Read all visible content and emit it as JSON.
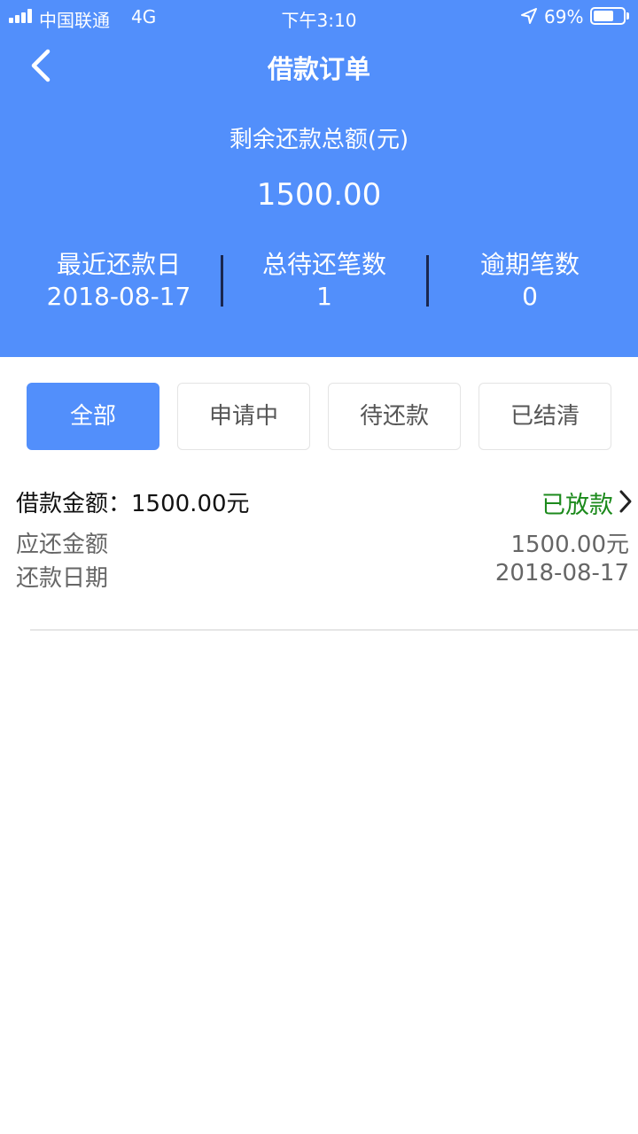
{
  "status_bar": {
    "carrier": "中国联通",
    "network": "4G",
    "time": "下午3:10",
    "battery_percent": "69%",
    "battery_level": 0.69
  },
  "nav": {
    "title": "借款订单",
    "back_icon": "chevron-left-icon"
  },
  "summary": {
    "label": "剩余还款总额(元)",
    "amount": "1500.00",
    "stats": [
      {
        "label": "最近还款日",
        "value": "2018-08-17"
      },
      {
        "label": "总待还笔数",
        "value": "1"
      },
      {
        "label": "逾期笔数",
        "value": "0"
      }
    ]
  },
  "tabs": [
    {
      "label": "全部",
      "active": true
    },
    {
      "label": "申请中",
      "active": false
    },
    {
      "label": "待还款",
      "active": false
    },
    {
      "label": "已结清",
      "active": false
    }
  ],
  "orders": [
    {
      "loan_amount_label": "借款金额：",
      "loan_amount": "1500.00元",
      "status": "已放款",
      "due_amount_label": "应还金额",
      "due_amount": "1500.00元",
      "due_date_label": "还款日期",
      "due_date": "2018-08-17"
    }
  ],
  "colors": {
    "primary": "#528ffb",
    "status_green": "#1c8a1c",
    "divider_dark": "#1a2750"
  }
}
